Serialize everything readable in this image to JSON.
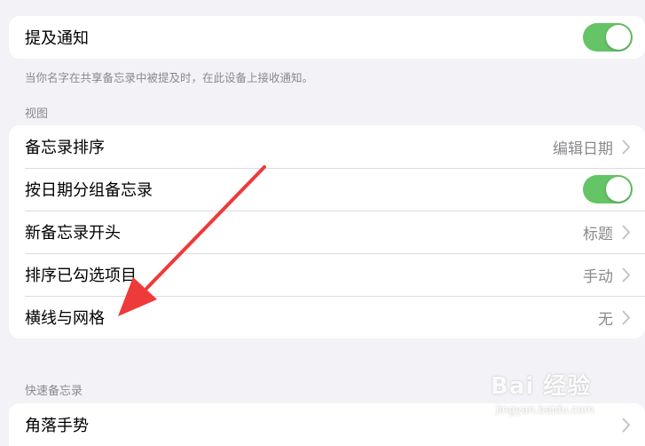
{
  "mentions": {
    "label": "提及通知",
    "toggle_on": true,
    "footnote": "当你名字在共享备忘录中被提及时，在此设备上接收通知。"
  },
  "view_section": {
    "header": "视图",
    "rows": [
      {
        "label": "备忘录排序",
        "value": "编辑日期"
      },
      {
        "label": "按日期分组备忘录",
        "toggle_on": true
      },
      {
        "label": "新备忘录开头",
        "value": "标题"
      },
      {
        "label": "排序已勾选项目",
        "value": "手动"
      },
      {
        "label": "横线与网格",
        "value": "无"
      }
    ]
  },
  "quick_notes": {
    "header": "快速备忘录",
    "rows": [
      {
        "label": "角落手势"
      }
    ]
  },
  "annotation": {
    "color": "#ee3a3a"
  },
  "watermark": {
    "brand": "Bai 经验",
    "url": "jingyan.baidu.com"
  },
  "colors": {
    "toggle_on": "#65c466",
    "background": "#f2f2f7"
  }
}
